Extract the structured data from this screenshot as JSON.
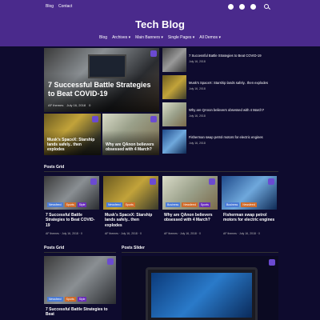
{
  "topbar": {
    "links": [
      "Blog",
      "Contact"
    ],
    "social": [
      "facebook-icon",
      "twitter-icon",
      "youtube-icon"
    ],
    "search_icon": "search-icon"
  },
  "header": {
    "title": "Tech Blog",
    "nav": [
      "Blog",
      "Archives ▾",
      "Main Banners ▾",
      "Single Pages ▾",
      "All Demos ▾"
    ]
  },
  "hero": {
    "main": {
      "title": "7 Successful Battle Strategies to Beat COVID-19",
      "meta": [
        "AF themes",
        "July 16, 2018",
        "0"
      ]
    },
    "sub1": {
      "title": "Musk's SpaceX: Starship lands safely.. then explodes"
    },
    "sub2": {
      "title": "Why are QAnon believers obsessed with 4 March?"
    }
  },
  "sidebar_list": [
    {
      "title": "7 Successful Battle Strategies to Beat COVID-19",
      "date": "July 16, 2018"
    },
    {
      "title": "Musk's SpaceX: Starship lands safely.. then explodes",
      "date": "July 16, 2018"
    },
    {
      "title": "Why are QAnon believers obsessed with 4 March?",
      "date": "July 16, 2018"
    },
    {
      "title": "Fisherman swap petrol motors for electric engines",
      "date": "July 16, 2018"
    }
  ],
  "posts_grid": {
    "heading": "Posts Grid",
    "items": [
      {
        "title": "7 Successful Battle Strategies to Beat COVID-19",
        "meta": "AF themes  ·  July 16, 2018  ·  0",
        "tags": [
          "Newsfeed",
          "Sports",
          "Style"
        ]
      },
      {
        "title": "Musk's SpaceX: Starship lands safely.. then explodes",
        "meta": "AF themes  ·  July 16, 2018  ·  0",
        "tags": [
          "Newsfeed",
          "Sports"
        ]
      },
      {
        "title": "Why are QAnon believers obsessed with 4 March?",
        "meta": "AF themes  ·  July 16, 2018  ·  0",
        "tags": [
          "Business",
          "Newsfeed",
          "Sports"
        ]
      },
      {
        "title": "Fisherman swap petrol motors for electric engines",
        "meta": "AF themes  ·  July 16, 2018  ·  0",
        "tags": [
          "Business",
          "Newsfeed"
        ]
      }
    ]
  },
  "bottom": {
    "grid_heading": "Posts Grid",
    "slider_heading": "Posts Slider",
    "grid_item": {
      "title": "7 Successful Battle Strategies to Beat",
      "tags": [
        "Newsfeed",
        "Sports",
        "Style"
      ]
    }
  }
}
